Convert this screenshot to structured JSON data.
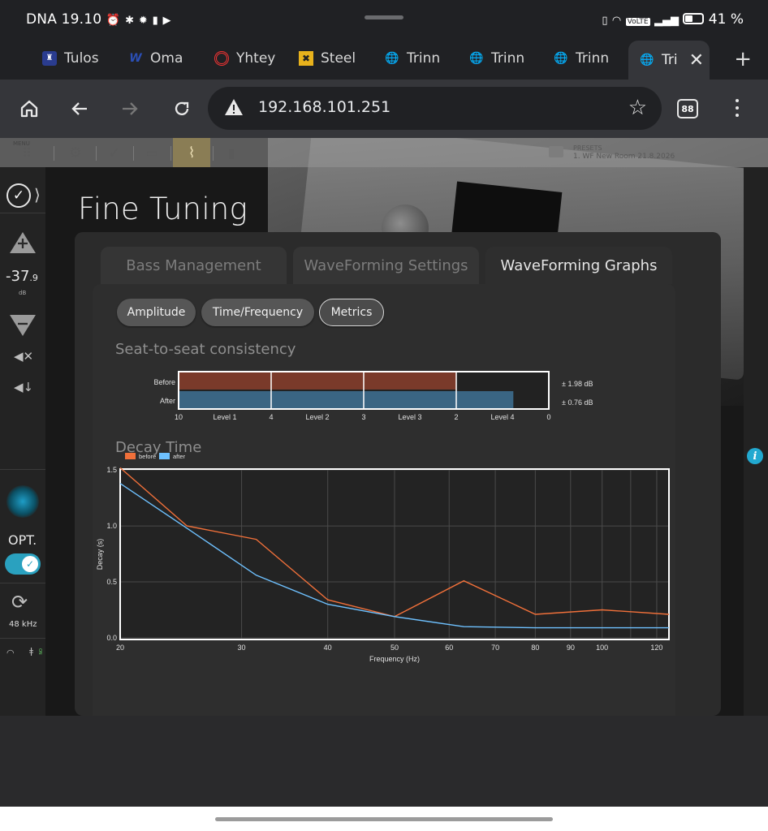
{
  "status_bar": {
    "left_text": "DNA 19.10",
    "battery": "41 %",
    "volte": "VoLTE"
  },
  "tabs": [
    {
      "label": "Tulos",
      "icon": "shield-icon"
    },
    {
      "label": "Oma",
      "icon": "w-icon"
    },
    {
      "label": "Yhtey",
      "icon": "ring-icon"
    },
    {
      "label": "Steel",
      "icon": "grid-icon"
    },
    {
      "label": "Trinn",
      "icon": "globe-icon"
    },
    {
      "label": "Trinn",
      "icon": "globe-icon"
    },
    {
      "label": "Trinn",
      "icon": "globe-icon"
    },
    {
      "label": "Tri",
      "icon": "globe-icon",
      "active": true
    }
  ],
  "toolbar": {
    "url": "192.168.101.251",
    "tab_count": "88"
  },
  "app": {
    "menu_label": "MENU",
    "preset_title": "PRESETS",
    "preset_name": "1. WF New Room 21.8.2026",
    "page_title": "Fine Tuning",
    "volume": {
      "value": "-37",
      "decimal": ".9",
      "unit": "dB"
    },
    "input": {
      "name": "OPT.",
      "sample_rate": "48 kHz"
    },
    "main_tabs": [
      "Bass Management",
      "WaveForming Settings",
      "WaveForming Graphs"
    ],
    "sub_tabs": [
      "Amplitude",
      "Time/Frequency",
      "Metrics"
    ],
    "section_seat": "Seat-to-seat consistency",
    "section_decay": "Decay Time"
  },
  "chart_data": [
    {
      "type": "bar",
      "orientation": "horizontal",
      "categories": [
        "Before",
        "After"
      ],
      "values_db": [
        1.98,
        0.76
      ],
      "value_labels": [
        "± 1.98 dB",
        "± 0.76 dB"
      ],
      "colors": {
        "Before": "#7a3a2a",
        "After": "#3a6583"
      },
      "axis_ticks": [
        "10",
        "4",
        "3",
        "2",
        "0"
      ],
      "bands": [
        "Level 1",
        "Level 2",
        "Level 3",
        "Level 4"
      ],
      "before_fill_fraction": 0.75,
      "after_fill_fraction": 0.906
    },
    {
      "type": "line",
      "xscale": "log",
      "xlabel": "Frequency (Hz)",
      "ylabel": "Decay (s)",
      "xlim": [
        20,
        125
      ],
      "ylim": [
        0,
        1.5
      ],
      "xticks": [
        20,
        30,
        40,
        50,
        60,
        70,
        80,
        90,
        100,
        120
      ],
      "yticks": [
        "0.0",
        "0.5",
        "1.0",
        "1.5"
      ],
      "legend_position": "top-left",
      "series": [
        {
          "name": "before",
          "color": "#f0703a",
          "x": [
            20,
            25,
            31.5,
            40,
            50,
            63,
            80,
            100,
            125
          ],
          "y": [
            1.52,
            1.0,
            0.88,
            0.34,
            0.19,
            0.51,
            0.21,
            0.25,
            0.21
          ]
        },
        {
          "name": "after",
          "color": "#6ec1ff",
          "x": [
            20,
            25,
            31.5,
            40,
            50,
            63,
            80,
            100,
            125
          ],
          "y": [
            1.38,
            0.98,
            0.56,
            0.3,
            0.19,
            0.1,
            0.09,
            0.09,
            0.09
          ]
        }
      ]
    }
  ]
}
